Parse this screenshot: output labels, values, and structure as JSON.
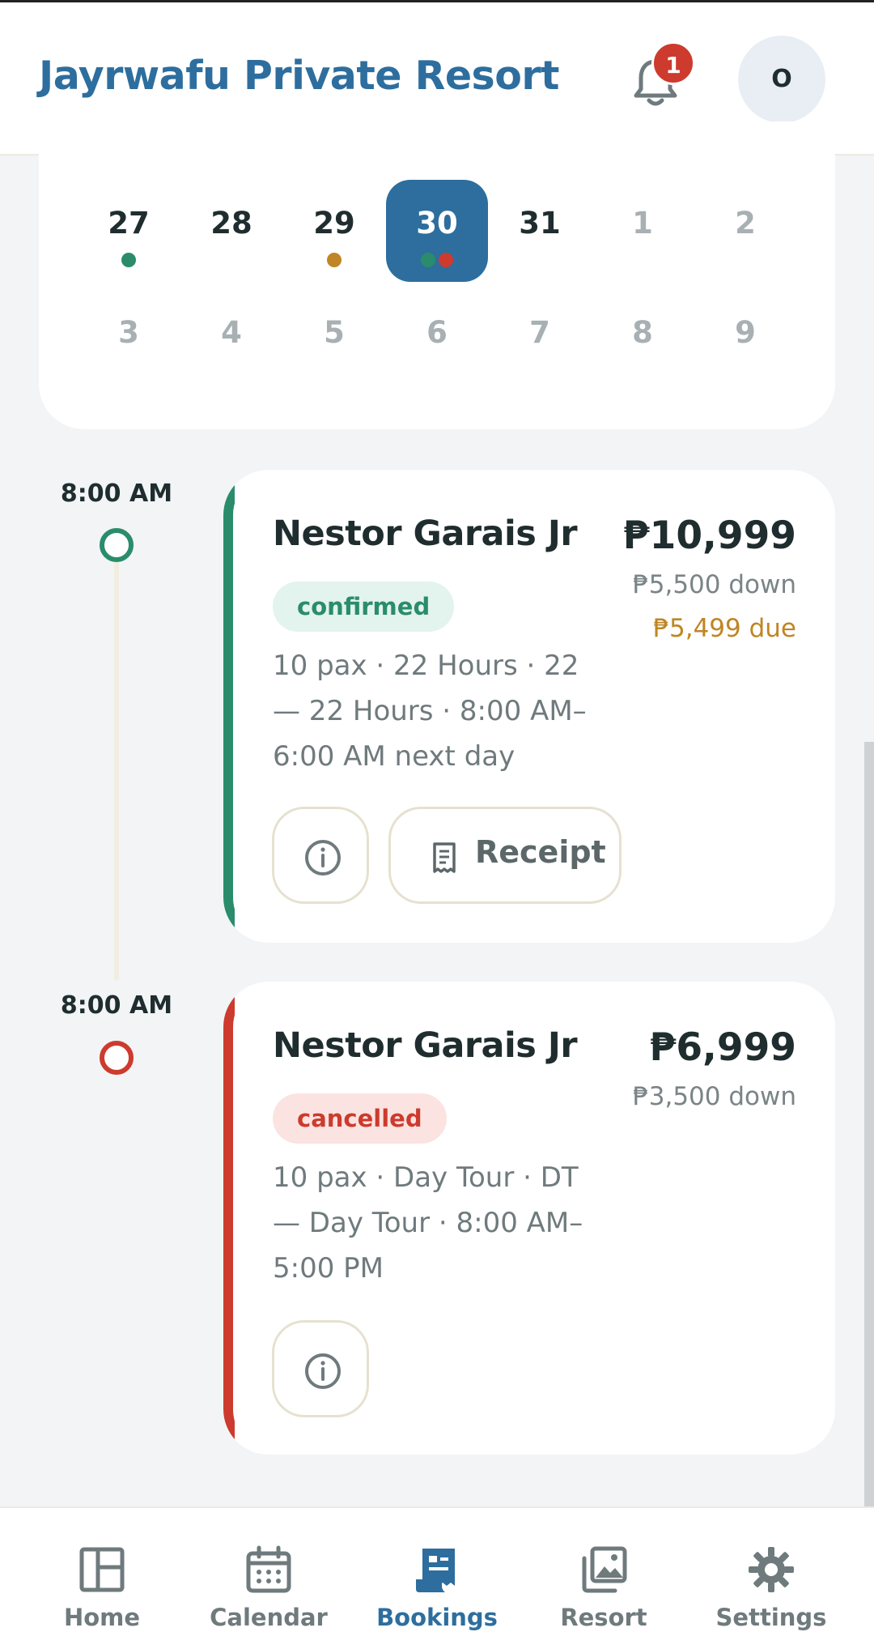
{
  "header": {
    "title": "Jayrwafu Private Resort",
    "notification_count": "1",
    "avatar_initial": "O"
  },
  "calendar": {
    "week1": [
      {
        "day": "27",
        "dots": [
          "#2a8c6b"
        ],
        "muted": false,
        "selected": false
      },
      {
        "day": "28",
        "dots": [],
        "muted": false,
        "selected": false
      },
      {
        "day": "29",
        "dots": [
          "#c08524"
        ],
        "muted": false,
        "selected": false
      },
      {
        "day": "30",
        "dots": [
          "#2a8c6b",
          "#cc3b2e"
        ],
        "muted": false,
        "selected": true
      },
      {
        "day": "31",
        "dots": [],
        "muted": false,
        "selected": false
      },
      {
        "day": "1",
        "dots": [],
        "muted": true,
        "selected": false
      },
      {
        "day": "2",
        "dots": [],
        "muted": true,
        "selected": false
      }
    ],
    "week2": [
      {
        "day": "3",
        "muted": true
      },
      {
        "day": "4",
        "muted": true
      },
      {
        "day": "5",
        "muted": true
      },
      {
        "day": "6",
        "muted": true
      },
      {
        "day": "7",
        "muted": true
      },
      {
        "day": "8",
        "muted": true
      },
      {
        "day": "9",
        "muted": true
      }
    ]
  },
  "bookings": [
    {
      "time": "8:00 AM",
      "name": "Nestor Garais Jr",
      "price": "₱10,999",
      "down": "₱5,500 down",
      "due": "₱5,499 due",
      "status": "confirmed",
      "description": "10 pax · 22 Hours · 22 — 22 Hours · 8:00 AM–6:00 AM next day",
      "receipt_label": "Receipt",
      "accent_color": "#2a8c6b",
      "status_bg": "#e3f3ed",
      "status_fg": "#2a8c6b"
    },
    {
      "time": "8:00 AM",
      "name": "Nestor Garais Jr",
      "price": "₱6,999",
      "down": "₱3,500 down",
      "status": "cancelled",
      "description": "10 pax · Day Tour · DT — Day Tour · 8:00 AM–5:00 PM",
      "accent_color": "#cc3b2e",
      "status_bg": "#fbe3e1",
      "status_fg": "#cc3b2e"
    }
  ],
  "bottom_nav": {
    "items": [
      {
        "label": "Home",
        "icon": "home-layout-icon",
        "active": false
      },
      {
        "label": "Calendar",
        "icon": "calendar-icon",
        "active": false
      },
      {
        "label": "Bookings",
        "icon": "bookings-receipt-icon",
        "active": true
      },
      {
        "label": "Resort",
        "icon": "gallery-icon",
        "active": false
      },
      {
        "label": "Settings",
        "icon": "gear-icon",
        "active": false
      }
    ]
  },
  "colors": {
    "brand": "#2d6e9e",
    "confirmed": "#2a8c6b",
    "cancelled": "#cc3b2e",
    "pending": "#c08524"
  }
}
